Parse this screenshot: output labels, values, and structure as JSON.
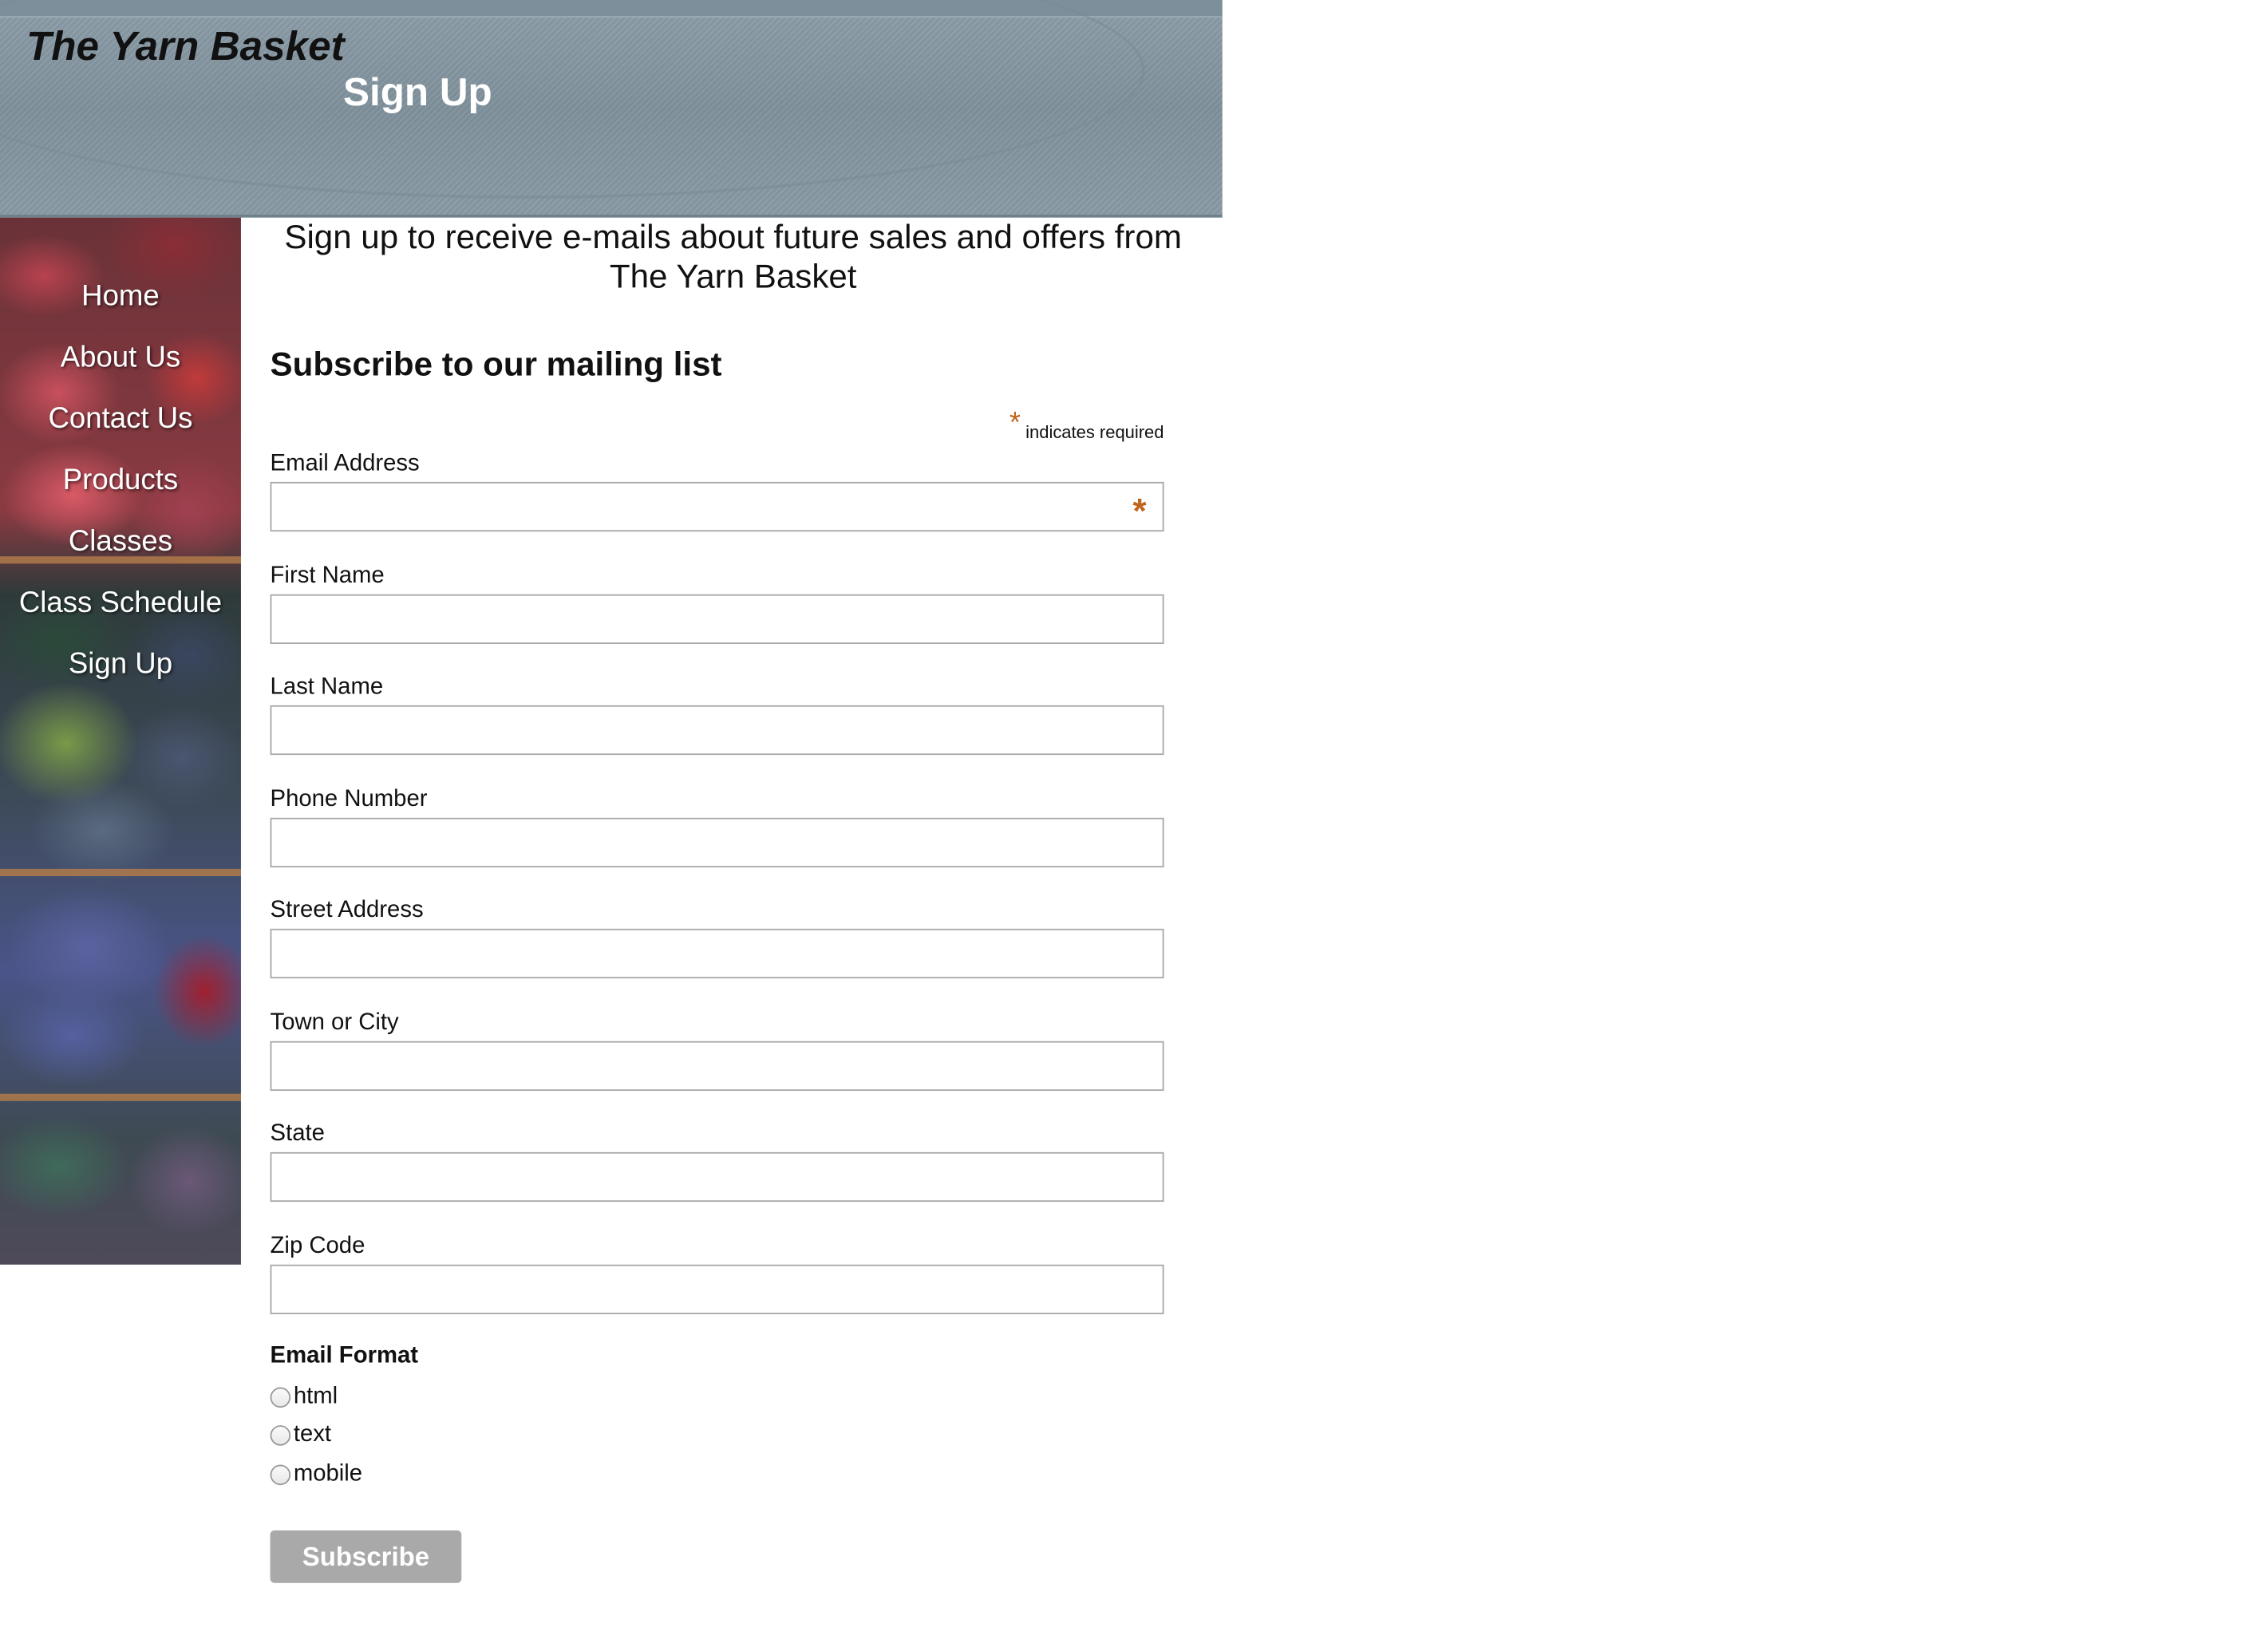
{
  "header": {
    "site_title": "The Yarn Basket",
    "page_heading": "Sign Up"
  },
  "nav": {
    "items": [
      "Home",
      "About Us",
      "Contact Us",
      "Products",
      "Classes",
      "Class Schedule",
      "Sign Up"
    ]
  },
  "intro": "Sign up to receive e-mails about future sales and offers from The Yarn Basket",
  "form": {
    "title": "Subscribe to our mailing list",
    "required_star": "*",
    "required_note": "indicates required",
    "fields": [
      {
        "label": "Email Address",
        "value": "",
        "required": true
      },
      {
        "label": "First Name",
        "value": ""
      },
      {
        "label": "Last Name",
        "value": ""
      },
      {
        "label": "Phone Number",
        "value": ""
      },
      {
        "label": "Street Address",
        "value": ""
      },
      {
        "label": "Town or City",
        "value": ""
      },
      {
        "label": "State",
        "value": ""
      },
      {
        "label": "Zip Code",
        "value": ""
      }
    ],
    "email_format": {
      "label": "Email Format",
      "options": [
        "html",
        "text",
        "mobile"
      ]
    },
    "subscribe_label": "Subscribe"
  },
  "colors": {
    "required_star": "#c0651b",
    "header_bg": "#8597a2",
    "button_bg": "#a9a9a9"
  }
}
